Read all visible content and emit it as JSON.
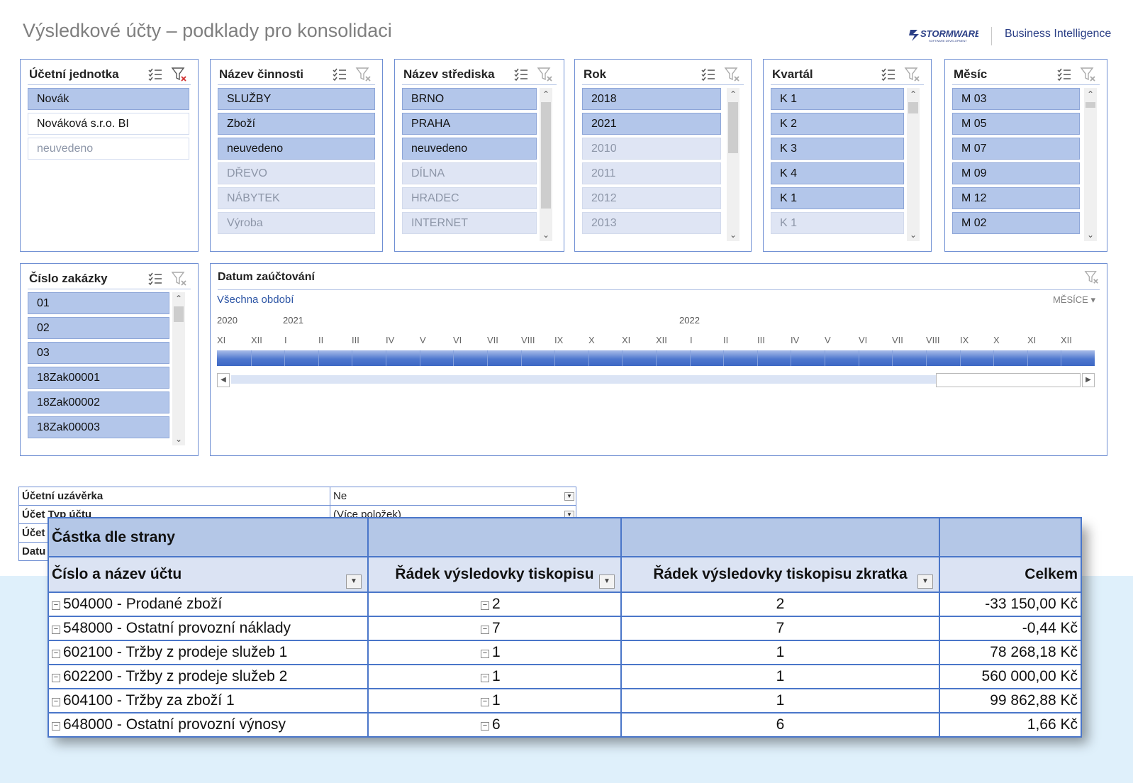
{
  "header": {
    "title": "Výsledkové účty – podklady pro konsolidaci",
    "logo_text": "STORMWARE",
    "logo_subtext": "SOFTWARE DEVELOPMENT",
    "bi_label": "Business Intelligence"
  },
  "slicers": {
    "ucetni_jednotka": {
      "title": "Účetní jednotka",
      "items": [
        {
          "label": "Novák",
          "state": "selected"
        },
        {
          "label": "Nováková s.r.o. BI",
          "state": "available"
        },
        {
          "label": "neuvedeno",
          "state": "no-data"
        }
      ]
    },
    "nazev_cinnosti": {
      "title": "Název činnosti",
      "items": [
        {
          "label": "SLUŽBY",
          "state": "selected"
        },
        {
          "label": "Zboží",
          "state": "selected"
        },
        {
          "label": "neuvedeno",
          "state": "selected"
        },
        {
          "label": "DŘEVO",
          "state": "no-data"
        },
        {
          "label": "NÁBYTEK",
          "state": "no-data"
        },
        {
          "label": "Výroba",
          "state": "no-data"
        }
      ]
    },
    "nazev_strediska": {
      "title": "Název střediska",
      "items": [
        {
          "label": "BRNO",
          "state": "selected"
        },
        {
          "label": "PRAHA",
          "state": "selected"
        },
        {
          "label": "neuvedeno",
          "state": "selected"
        },
        {
          "label": "DÍLNA",
          "state": "no-data"
        },
        {
          "label": "HRADEC",
          "state": "no-data"
        },
        {
          "label": "INTERNET",
          "state": "no-data"
        }
      ]
    },
    "rok": {
      "title": "Rok",
      "items": [
        {
          "label": "2018",
          "state": "selected"
        },
        {
          "label": "2021",
          "state": "selected"
        },
        {
          "label": "2010",
          "state": "no-data"
        },
        {
          "label": "2011",
          "state": "no-data"
        },
        {
          "label": "2012",
          "state": "no-data"
        },
        {
          "label": "2013",
          "state": "no-data"
        }
      ]
    },
    "kvartal": {
      "title": "Kvartál",
      "items": [
        {
          "label": "K 1",
          "state": "selected"
        },
        {
          "label": "K 2",
          "state": "selected"
        },
        {
          "label": "K 3",
          "state": "selected"
        },
        {
          "label": "K 4",
          "state": "selected"
        },
        {
          "label": "K 1",
          "state": "selected"
        },
        {
          "label": "K 1",
          "state": "no-data"
        }
      ]
    },
    "mesic": {
      "title": "Měsíc",
      "items": [
        {
          "label": "M 03",
          "state": "selected"
        },
        {
          "label": "M 05",
          "state": "selected"
        },
        {
          "label": "M 07",
          "state": "selected"
        },
        {
          "label": "M 09",
          "state": "selected"
        },
        {
          "label": "M 12",
          "state": "selected"
        },
        {
          "label": "M 02",
          "state": "selected"
        }
      ]
    },
    "cislo_zakazky": {
      "title": "Číslo zakázky",
      "items": [
        {
          "label": "01",
          "state": "selected"
        },
        {
          "label": "02",
          "state": "selected"
        },
        {
          "label": "03",
          "state": "selected"
        },
        {
          "label": "18Zak00001",
          "state": "selected"
        },
        {
          "label": "18Zak00002",
          "state": "selected"
        },
        {
          "label": "18Zak00003",
          "state": "selected"
        }
      ]
    }
  },
  "timeline": {
    "title": "Datum zaúčtování",
    "period_label": "Všechna období",
    "level_label": "MĚSÍCE",
    "years": [
      "2020",
      "2021",
      "2022"
    ],
    "months": [
      "XI",
      "XII",
      "I",
      "II",
      "III",
      "IV",
      "V",
      "VI",
      "VII",
      "VIII",
      "IX",
      "X",
      "XI",
      "XII",
      "I",
      "II",
      "III",
      "IV",
      "V",
      "VI",
      "VII",
      "VIII",
      "IX",
      "X",
      "XI",
      "XII"
    ]
  },
  "report_filters": [
    {
      "label": "Účetní uzávěrka",
      "value": "Ne"
    },
    {
      "label": "Účet Typ účtu",
      "value": "(Více položek)"
    },
    {
      "label": "Účet",
      "value": ""
    },
    {
      "label": "Datu",
      "value": ""
    }
  ],
  "pivot": {
    "value_header": "Částka dle strany",
    "columns": [
      "Číslo a název účtu",
      "Řádek výsledovky tiskopisu",
      "Řádek výsledovky tiskopisu zkratka",
      "Celkem"
    ],
    "collapse_symbol": "⊟",
    "rows": [
      {
        "account": "504000 - Prodané zboží",
        "line": "2",
        "short": "2",
        "total": "-33 150,00 Kč"
      },
      {
        "account": "548000 - Ostatní provozní náklady",
        "line": "7",
        "short": "7",
        "total": "-0,44 Kč"
      },
      {
        "account": "602100 - Tržby z prodeje služeb 1",
        "line": "1",
        "short": "1",
        "total": "78 268,18 Kč"
      },
      {
        "account": "602200 - Tržby z prodeje služeb 2",
        "line": "1",
        "short": "1",
        "total": "560 000,00 Kč"
      },
      {
        "account": "604100 - Tržby za zboží 1",
        "line": "1",
        "short": "1",
        "total": "99 862,88 Kč"
      },
      {
        "account": "648000 - Ostatní provozní výnosy",
        "line": "6",
        "short": "6",
        "total": "1,66 Kč"
      }
    ]
  },
  "colors": {
    "accent_border": "#6f8fd3",
    "selected_item": "#b3c6ea",
    "pivot_header": "#b4c7e7",
    "timeline_bar": "#4f78cf",
    "background_band": "#dff0fb"
  }
}
